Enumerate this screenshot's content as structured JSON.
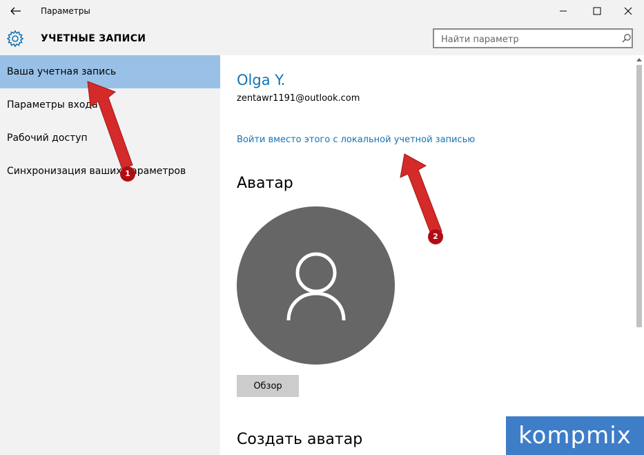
{
  "window": {
    "title": "Параметры"
  },
  "header": {
    "title": "УЧЕТНЫЕ ЗАПИСИ"
  },
  "search": {
    "placeholder": "Найти параметр"
  },
  "sidebar": {
    "items": [
      {
        "label": "Ваша учетная запись",
        "active": true
      },
      {
        "label": "Параметры входа",
        "active": false
      },
      {
        "label": "Рабочий доступ",
        "active": false
      },
      {
        "label": "Синхронизация ваших параметров",
        "active": false
      }
    ]
  },
  "account": {
    "name": "Olga Y.",
    "email": "zentawr1191@outlook.com",
    "local_link": "Войти вместо этого с локальной учетной записью"
  },
  "avatar": {
    "title": "Аватар",
    "browse_label": "Обзор",
    "create_title": "Создать аватар"
  },
  "annotations": {
    "step1": "1",
    "step2": "2",
    "arrow_color": "#d42a2a"
  },
  "watermark": {
    "text": "kompmix"
  },
  "colors": {
    "accent": "#1672b3",
    "selection": "#99c1e7",
    "avatar_bg": "#666666"
  }
}
